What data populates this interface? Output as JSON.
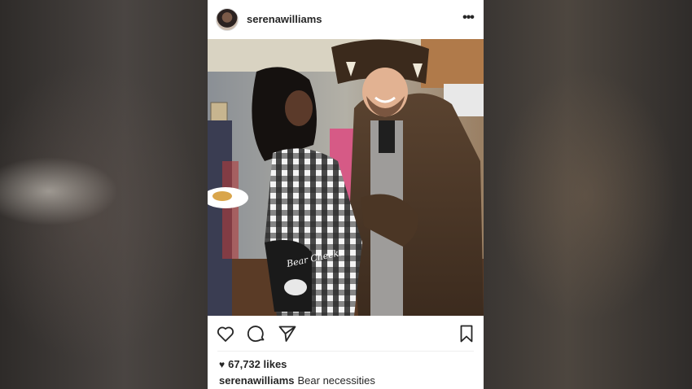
{
  "post": {
    "username": "serenawilliams",
    "more_icon": "more-dots-icon",
    "photo": {
      "description_icon": "photo",
      "garment_text": "Bear Cheeks"
    },
    "actions": {
      "like_icon": "heart-outline-icon",
      "comment_icon": "comment-icon",
      "share_icon": "share-paper-plane-icon",
      "save_icon": "bookmark-icon"
    },
    "likes": "67,732 likes",
    "caption": {
      "user": "serenawilliams",
      "text": "Bear necessities"
    }
  },
  "colors": {
    "text": "#262626",
    "card": "#ffffff",
    "background": "#3b3835"
  }
}
